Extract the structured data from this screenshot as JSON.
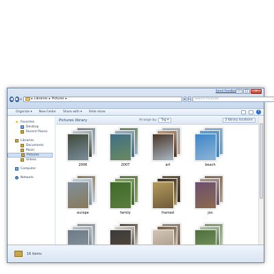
{
  "window": {
    "feedback_link": "Send Feedback",
    "minimize": "—",
    "maximize": "□",
    "close": "✕"
  },
  "navigation": {
    "back": "◀",
    "forward": "▶",
    "dropdown": "▾",
    "breadcrumb": [
      "Libraries",
      "Pictures"
    ],
    "separator": "▸",
    "refresh": "↻",
    "search_placeholder": "Search Pictures"
  },
  "toolbar": {
    "organize": "Organize ▾",
    "new_folder": "New Folder",
    "share_with": "Share with ▾",
    "slide_show": "Slide show",
    "help": "?"
  },
  "sidebar": {
    "favorites": {
      "label": "Favorites",
      "items": [
        "Desktop",
        "Recent Places"
      ]
    },
    "libraries": {
      "label": "Libraries",
      "items": [
        "Documents",
        "Music",
        "Pictures",
        "Videos"
      ],
      "active": "Pictures"
    },
    "computer": "Computer",
    "network": "Network"
  },
  "library": {
    "title": "Pictures library",
    "arrange_by_label": "Arrange by:",
    "arrange_by_value": "Tag ▾",
    "locations": "2 library locations"
  },
  "tiles": [
    {
      "label": "2006",
      "colors": [
        "#7a8d9c",
        "#c9cfd6",
        "#3f4a3a"
      ]
    },
    {
      "label": "2007",
      "colors": [
        "#6b8a5e",
        "#9fb3c4",
        "#3f6e86"
      ]
    },
    {
      "label": "art",
      "colors": [
        "#a9b8c4",
        "#c49e83",
        "#4a3528"
      ]
    },
    {
      "label": "beach",
      "colors": [
        "#8fb4d6",
        "#6aa0d2",
        "#3d86c9"
      ]
    },
    {
      "label": "europe",
      "colors": [
        "#8a7a5a",
        "#c7d4de",
        "#7f8f9c"
      ]
    },
    {
      "label": "family",
      "colors": [
        "#5b7d3e",
        "#8aa66a",
        "#3e6a2b"
      ]
    },
    {
      "label": "framed",
      "colors": [
        "#6e5a3a",
        "#3b2e1f",
        "#b59a5c"
      ]
    },
    {
      "label": "jon",
      "colors": [
        "#8c6a4f",
        "#b09f8e",
        "#6b4f6e"
      ]
    },
    {
      "label": "",
      "colors": [
        "#8c98a4",
        "#c2c8ce",
        "#6d7b86"
      ]
    },
    {
      "label": "",
      "colors": [
        "#5a4a3a",
        "#dcd6cc",
        "#3b3b3b"
      ]
    },
    {
      "label": "",
      "colors": [
        "#a28d7a",
        "#7a5e48",
        "#d1c6b8"
      ]
    },
    {
      "label": "",
      "colors": [
        "#7f9c6a",
        "#b7c7b0",
        "#4d6e3c"
      ]
    }
  ],
  "status": {
    "item_count": "16 items"
  }
}
